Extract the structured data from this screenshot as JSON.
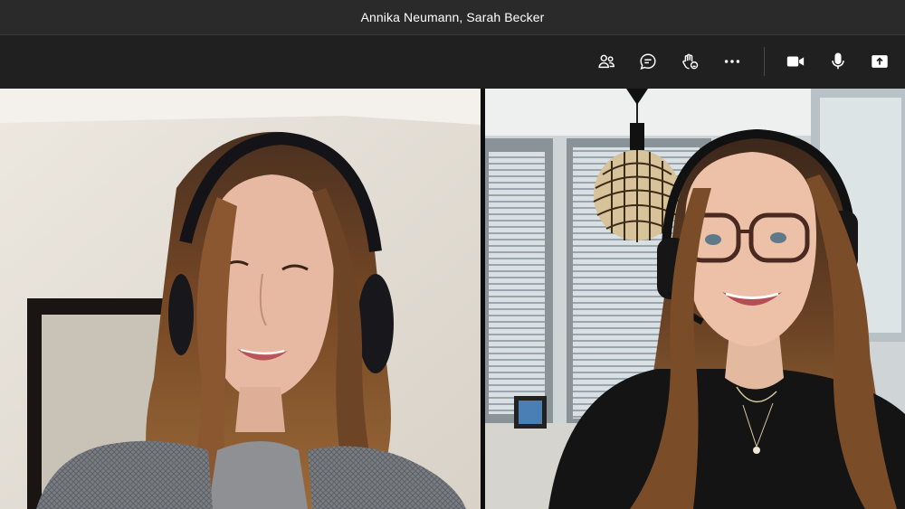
{
  "window": {
    "title": "Annika Neumann, Sarah Becker"
  },
  "toolbar": {
    "buttons": [
      {
        "id": "participants",
        "icon": "people-icon"
      },
      {
        "id": "chat",
        "icon": "chat-icon"
      },
      {
        "id": "reactions",
        "icon": "raise-hand-icon"
      },
      {
        "id": "more",
        "icon": "more-options-icon"
      },
      {
        "id": "camera",
        "icon": "video-camera-icon"
      },
      {
        "id": "microphone",
        "icon": "microphone-icon"
      },
      {
        "id": "share",
        "icon": "share-screen-icon"
      }
    ]
  },
  "participants": [
    {
      "position": "left",
      "description": "woman with headset, grey blazer, home background"
    },
    {
      "position": "right",
      "description": "woman with glasses and headset, black top, office background with pendant lamp"
    }
  ],
  "colors": {
    "titlebar_bg": "#2a2a2a",
    "toolbar_bg": "#202020",
    "icon_color": "#ffffff"
  }
}
